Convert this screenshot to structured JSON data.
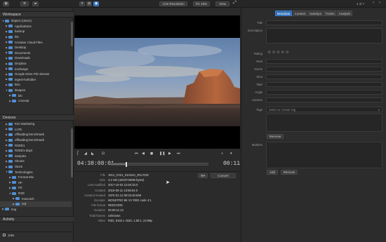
{
  "toolbar": {
    "resolution_label": "1/16 Resolution",
    "fit_label": "Fit: 15%",
    "view_label": "View",
    "counter": "4 of 7"
  },
  "left": {
    "workspace_title": "Workspace",
    "workspace_tree": [
      {
        "label": "ilrapen (Users)",
        "indent": 0,
        "expanded": true
      },
      {
        "label": "Applications",
        "indent": 1
      },
      {
        "label": "backup",
        "indent": 1
      },
      {
        "label": "bin",
        "indent": 1
      },
      {
        "label": "Creative Cloud Files",
        "indent": 1
      },
      {
        "label": "Desktop",
        "indent": 1
      },
      {
        "label": "Documents",
        "indent": 1
      },
      {
        "label": "Downloads",
        "indent": 1
      },
      {
        "label": "Dropbox",
        "indent": 1
      },
      {
        "label": "exchange",
        "indent": 1
      },
      {
        "label": "Google Drive File Stream",
        "indent": 1
      },
      {
        "label": "ingest-hotfolder",
        "indent": 1
      },
      {
        "label": "kiss",
        "indent": 1
      },
      {
        "label": "ktsapen",
        "indent": 1,
        "expanded": true
      },
      {
        "label": "bin",
        "indent": 2
      },
      {
        "label": "concept",
        "indent": 2
      }
    ],
    "devices_title": "Devices",
    "devices_tree": [
      {
        "label": "Kirn Marketing",
        "indent": 1
      },
      {
        "label": "LUTs",
        "indent": 1
      },
      {
        "label": "offloading-benchmark",
        "indent": 1
      },
      {
        "label": "offloading-benchmark",
        "indent": 1
      },
      {
        "label": "R3DD1",
        "indent": 1
      },
      {
        "label": "R3DD1-day2",
        "indent": 1
      },
      {
        "label": "samples",
        "indent": 1
      },
      {
        "label": "Shoots",
        "indent": 1
      },
      {
        "label": "Stock",
        "indent": 1
      },
      {
        "label": "Technologies",
        "indent": 1,
        "expanded": true
      },
      {
        "label": "Format Mix",
        "indent": 2
      },
      {
        "label": "HF",
        "indent": 2
      },
      {
        "label": "PZ",
        "indent": 2
      },
      {
        "label": "R3D",
        "indent": 2,
        "expanded": true
      },
      {
        "label": "Imscotch",
        "indent": 3
      },
      {
        "label": "red",
        "indent": 3,
        "selected": true
      },
      {
        "label": "tmp",
        "indent": 0
      }
    ],
    "activity_title": "Activity",
    "jobs_label": "Jobs"
  },
  "player": {
    "timecode_in": "04:38:08:01",
    "timecode_out": "00:11:13",
    "progress": 0.15
  },
  "metadata": {
    "convert_label": "Convert",
    "rows": [
      {
        "k": "File",
        "v": "J012_C021_0104SU_001.R3D"
      },
      {
        "k": "Size",
        "v": "4.2 GB (4203719296 bytes)"
      },
      {
        "k": "Last modified",
        "v": "2017-10-02 12:50:33.0"
      },
      {
        "k": "Created",
        "v": "2018-09-11 13:58:54.0"
      },
      {
        "k": "Content created",
        "v": "1970-01-12 00:02:40.699"
      },
      {
        "k": "Encoder",
        "v": "MONSTRO 8K VV RED code 4:1"
      },
      {
        "k": "File format",
        "v": "REDCODE"
      },
      {
        "k": "Duration",
        "v": "00:00:11:13"
      },
      {
        "k": "Total frames",
        "v": "Unknown"
      },
      {
        "k": "Video",
        "v": "R3D, 8192 x 4320, 1.90:1, 23.98p"
      }
    ]
  },
  "right": {
    "tabs": [
      "Metadata",
      "Content",
      "Subclips",
      "Tracks",
      "Analysis"
    ],
    "labels": {
      "title": "Title",
      "description": "Description",
      "rating": "Rating",
      "reel": "Reel",
      "scene": "Scene",
      "shot": "Shot",
      "take": "Take",
      "angle": "Angle",
      "camera": "Camera",
      "tags": "Tags",
      "markers": "Markers"
    },
    "tags_placeholder": "Select or Create Tag",
    "remove_label": "Remove",
    "add_label": "Add",
    "remove2_label": "Remove",
    "stars": "☆☆☆☆☆"
  }
}
